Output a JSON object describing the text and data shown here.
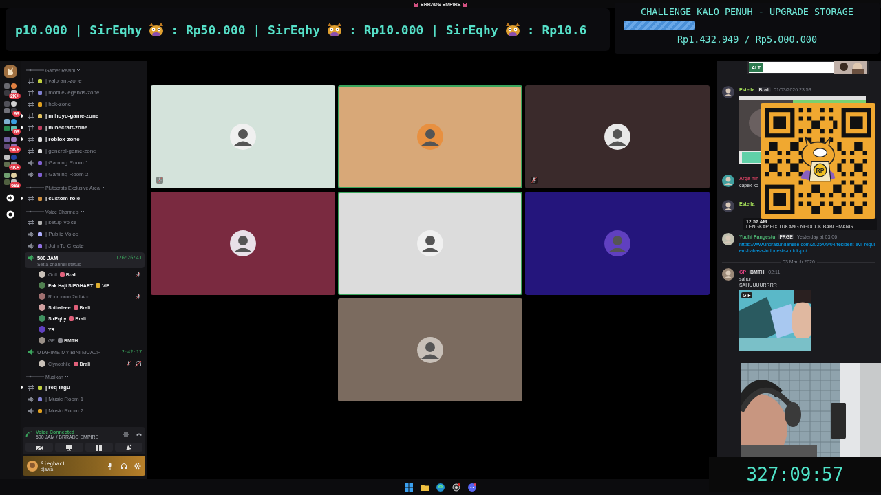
{
  "window": {
    "title": "BRRADS EMPIRE"
  },
  "ticker": {
    "segments": [
      "p10.000 | SirEqhy",
      ": Rp50.000 | SirEqhy",
      ": Rp10.000 | SirEqhy",
      ": Rp10.6"
    ]
  },
  "goal": {
    "title": "CHALLENGE KALO PENUH - UPGRADE STORAGE",
    "level": 0.29,
    "amount": "Rp1.432.949 / Rp5.000.000"
  },
  "servers": [
    {
      "kind": "server"
    },
    {
      "kind": "folder",
      "badge": "2K+"
    },
    {
      "kind": "folder",
      "badge": "93"
    },
    {
      "kind": "folder",
      "badge": "63"
    },
    {
      "kind": "folder",
      "badge": "5K+"
    },
    {
      "kind": "folder",
      "badge": "4K+"
    },
    {
      "kind": "folder",
      "badge": "683"
    }
  ],
  "channels": [
    {
      "kind": "category",
      "name": "Gamer Realm",
      "expanded": true
    },
    {
      "kind": "text",
      "name": "| valorant-zone",
      "unread": false
    },
    {
      "kind": "text",
      "name": "| mobile-legends-zone",
      "unread": false
    },
    {
      "kind": "text",
      "name": "| hok-zone",
      "unread": false
    },
    {
      "kind": "text",
      "name": "| mihoyo-game-zone",
      "unread": true
    },
    {
      "kind": "text",
      "name": "| minecraft-zone",
      "unread": true
    },
    {
      "kind": "text",
      "name": "| roblox-zone",
      "unread": true
    },
    {
      "kind": "text",
      "name": "| general-game-zone",
      "unread": false
    },
    {
      "kind": "voice",
      "name": "| Gaming Room 1"
    },
    {
      "kind": "voice",
      "name": "| Gaming Room 2"
    },
    {
      "kind": "category",
      "name": "Plutocrats Exclusive Area",
      "expanded": false
    },
    {
      "kind": "text",
      "name": "| custom-role",
      "unread": true
    },
    {
      "kind": "category",
      "name": "Voice Channels",
      "expanded": true
    },
    {
      "kind": "text",
      "name": "| setup-voice",
      "unread": false
    },
    {
      "kind": "voice",
      "name": "| Public Voice"
    },
    {
      "kind": "voice",
      "name": "| Join To Create"
    },
    {
      "kind": "voice",
      "name": "500 JAM",
      "selected": true,
      "duration": "126:26:41",
      "status": "Set a channel status",
      "members": [
        {
          "name": "Ontl",
          "badge": "Brali",
          "color": "#e0607a",
          "dim": true,
          "muted": true
        },
        {
          "name": "Pak Haji SIEGHART",
          "badge": "VIP",
          "color": "#e0b030",
          "dim": false,
          "muted": false
        },
        {
          "name": "Ronronron 2nd Acc",
          "dim": true,
          "muted": true
        },
        {
          "name": "Shibaleee",
          "badge": "Brali",
          "color": "#e0607a",
          "dim": false,
          "muted": false
        },
        {
          "name": "SirEqhy",
          "badge": "Brali",
          "color": "#e0607a",
          "dim": false,
          "muted": false
        },
        {
          "name": "YR",
          "dim": false,
          "muted": false
        },
        {
          "name": "GP",
          "badge": "BMTH",
          "color": "#8a8a90",
          "dim": true,
          "muted": false
        }
      ]
    },
    {
      "kind": "voice",
      "name": "UTAHIME MY BINI MUACH",
      "selected": false,
      "duration": "2:42:17",
      "members": [
        {
          "name": "Clynophile",
          "badge": "Brali",
          "color": "#e0607a",
          "dim": true,
          "muted": true,
          "deafened": true
        }
      ]
    },
    {
      "kind": "category",
      "name": "Musikan",
      "expanded": true
    },
    {
      "kind": "text",
      "name": "| req-lagu",
      "unread": true
    },
    {
      "kind": "voice",
      "name": "| Music Room 1"
    },
    {
      "kind": "voice",
      "name": "| Music Room 2"
    }
  ],
  "voice_panel": {
    "status": "Voice Connected",
    "location": "500 JAM / BRRADS EMPIRE"
  },
  "user": {
    "name": "Sieghart",
    "status": "djawa"
  },
  "tiles": [
    {
      "color": "#d4e3db",
      "speaking": false,
      "muted": true
    },
    {
      "color": "#d8a878",
      "speaking": true,
      "muted": false
    },
    {
      "color": "#3a2a2b",
      "speaking": false,
      "muted": true
    },
    {
      "color": "#7a2a40",
      "speaking": false,
      "muted": false
    },
    {
      "color": "#dcdcdc",
      "speaking": true,
      "muted": false
    },
    {
      "color": "#24157c",
      "speaking": false,
      "muted": false
    },
    {
      "color": "#7b6b5f",
      "speaking": false,
      "muted": false
    }
  ],
  "chat": [
    {
      "kind": "embed",
      "label": "ALT"
    },
    {
      "kind": "message",
      "author": "Estella",
      "color": "#a6e05a",
      "badge": "Brali",
      "time": "01/03/2026 23:53",
      "image": true
    },
    {
      "kind": "message",
      "author": "Arga nih",
      "color": "#d04060",
      "lines": [
        "capek ko"
      ]
    },
    {
      "kind": "message",
      "author": "Estella",
      "color": "#a6e05a",
      "quote_time": "12:57 AM",
      "quote": "LENGKAP FIX TUKANG NGOCOK BABI EMANG"
    },
    {
      "kind": "message",
      "author": "Yudhi Pangestu",
      "color": "#4caf70",
      "badge": "FRGE",
      "time": "Yesterday at 03:06",
      "link": "https://www.indrasundanese.com/2025/09/04/resident-evil-requiem-bahasa-indonesia-untuk-pc/"
    },
    {
      "kind": "divider",
      "text": "03 March 2026"
    },
    {
      "kind": "message",
      "author": "GP",
      "color": "#e04080",
      "badge": "BMTH",
      "time": "02:11",
      "lines": [
        "sahur",
        "SAHUUUURRRR"
      ],
      "gif_label": "GIF"
    }
  ],
  "qr": {
    "label": "RP"
  },
  "timer": "327:09:57"
}
